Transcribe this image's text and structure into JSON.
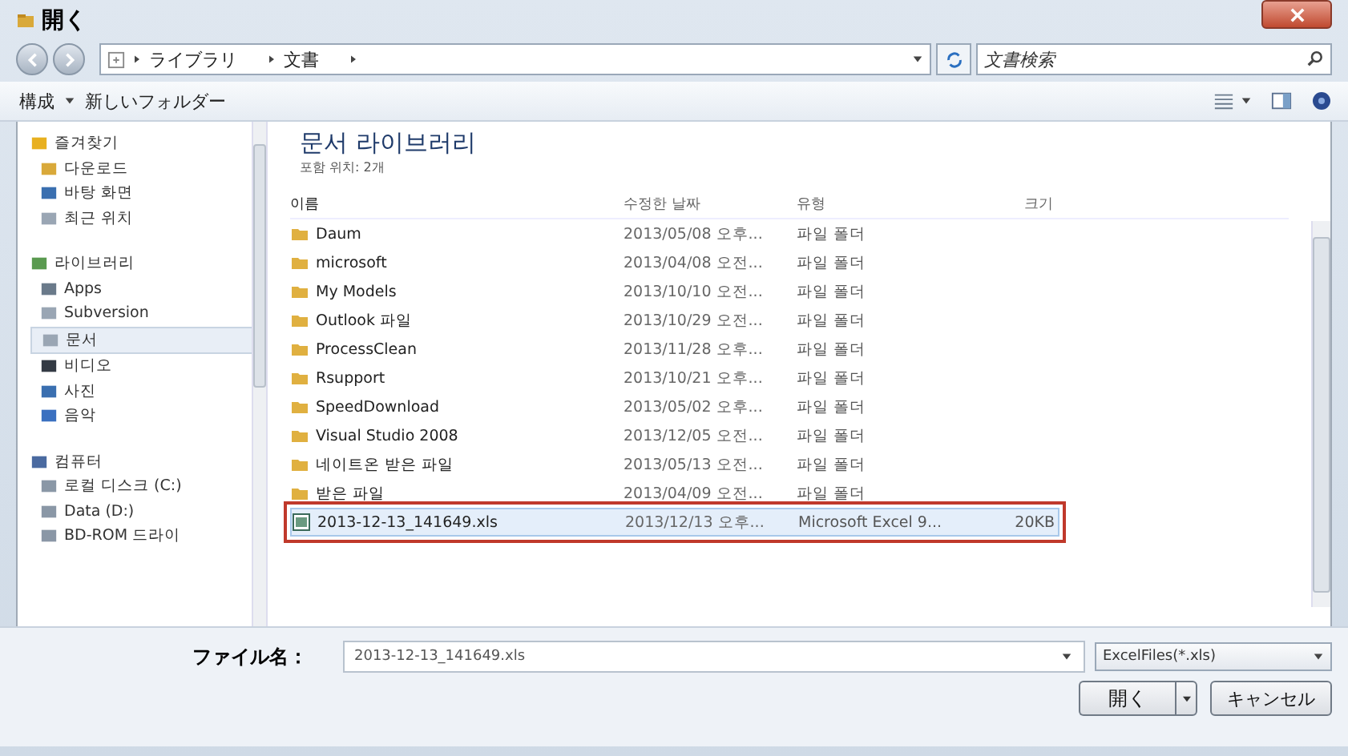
{
  "window": {
    "title": "開く"
  },
  "address": {
    "crumbs": [
      "ライブラリ",
      "文書"
    ],
    "search_placeholder": "文書検索"
  },
  "toolbar": {
    "organize": "構成",
    "new_folder": "新しいフォルダー"
  },
  "sidebar": [
    {
      "label": "즐겨찾기",
      "selected": false,
      "children": [
        {
          "label": "다운로드",
          "selected": false
        },
        {
          "label": "바탕 화면",
          "selected": false
        },
        {
          "label": "최근 위치",
          "selected": false
        }
      ]
    },
    {
      "label": "라이브러리",
      "selected": false,
      "children": [
        {
          "label": "Apps",
          "selected": false
        },
        {
          "label": "Subversion",
          "selected": false
        },
        {
          "label": "문서",
          "selected": true
        },
        {
          "label": "비디오",
          "selected": false
        },
        {
          "label": "사진",
          "selected": false
        },
        {
          "label": "음악",
          "selected": false
        }
      ]
    },
    {
      "label": "컴퓨터",
      "selected": false,
      "children": [
        {
          "label": "로컬 디스크 (C:)",
          "selected": false
        },
        {
          "label": "Data (D:)",
          "selected": false
        },
        {
          "label": "BD-ROM 드라이",
          "selected": false
        }
      ]
    }
  ],
  "library": {
    "title": "문서 라이브러리",
    "subtitle": "포함 위치: 2개"
  },
  "table": {
    "columns": [
      "이름",
      "수정한 날짜",
      "유형",
      "크기"
    ],
    "rows": [
      {
        "kind": "folder",
        "name": "Daum",
        "date": "2013/05/08 오후...",
        "type": "파일 폴더",
        "size": "",
        "selected": false,
        "annotated": false
      },
      {
        "kind": "folder",
        "name": "microsoft",
        "date": "2013/04/08 오전...",
        "type": "파일 폴더",
        "size": "",
        "selected": false,
        "annotated": false
      },
      {
        "kind": "folder",
        "name": "My Models",
        "date": "2013/10/10 오전...",
        "type": "파일 폴더",
        "size": "",
        "selected": false,
        "annotated": false
      },
      {
        "kind": "folder",
        "name": "Outlook 파일",
        "date": "2013/10/29 오전...",
        "type": "파일 폴더",
        "size": "",
        "selected": false,
        "annotated": false
      },
      {
        "kind": "folder",
        "name": "ProcessClean",
        "date": "2013/11/28 오후...",
        "type": "파일 폴더",
        "size": "",
        "selected": false,
        "annotated": false
      },
      {
        "kind": "folder",
        "name": "Rsupport",
        "date": "2013/10/21 오후...",
        "type": "파일 폴더",
        "size": "",
        "selected": false,
        "annotated": false
      },
      {
        "kind": "folder",
        "name": "SpeedDownload",
        "date": "2013/05/02 오후...",
        "type": "파일 폴더",
        "size": "",
        "selected": false,
        "annotated": false
      },
      {
        "kind": "folder",
        "name": "Visual Studio 2008",
        "date": "2013/12/05 오전...",
        "type": "파일 폴더",
        "size": "",
        "selected": false,
        "annotated": false
      },
      {
        "kind": "folder",
        "name": "네이트온 받은 파일",
        "date": "2013/05/13 오전...",
        "type": "파일 폴더",
        "size": "",
        "selected": false,
        "annotated": false
      },
      {
        "kind": "folder",
        "name": "받은 파일",
        "date": "2013/04/09 오전...",
        "type": "파일 폴더",
        "size": "",
        "selected": false,
        "annotated": false
      },
      {
        "kind": "excel",
        "name": "2013-12-13_141649.xls",
        "date": "2013/12/13 오후...",
        "type": "Microsoft Excel 9...",
        "size": "20KB",
        "selected": true,
        "annotated": true
      }
    ]
  },
  "footer": {
    "filename_label": "ファイル名：",
    "filename": "2013-12-13_141649.xls",
    "filetype": "ExcelFiles(*.xls)",
    "open": "開く",
    "cancel": "キャンセル"
  }
}
